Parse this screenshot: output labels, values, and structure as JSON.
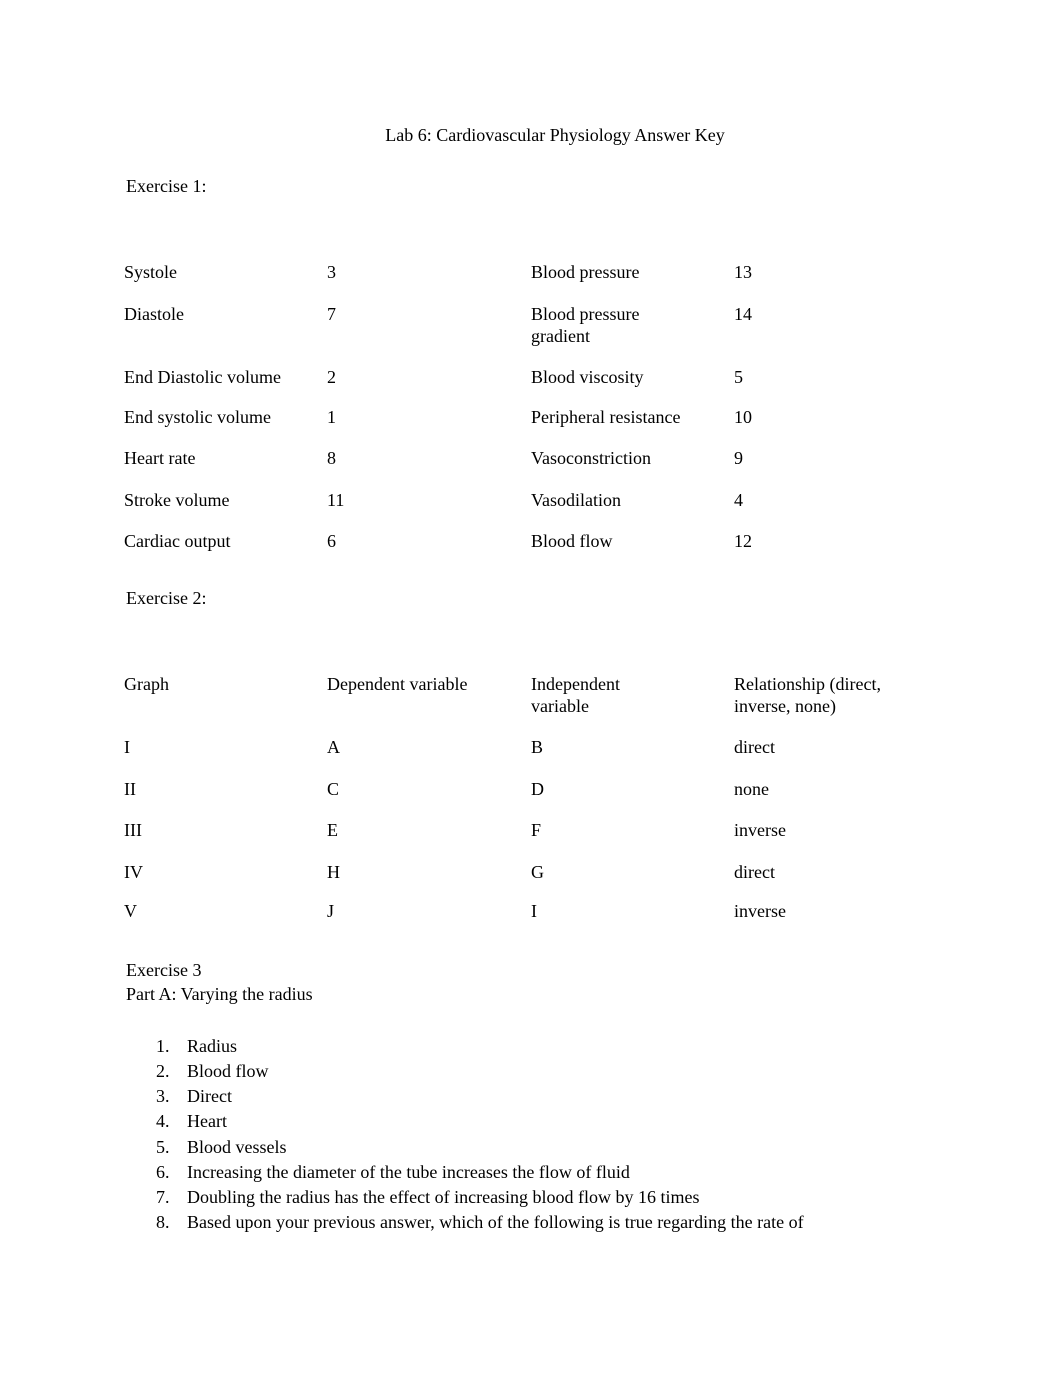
{
  "title": "Lab 6: Cardiovascular Physiology Answer Key",
  "exercise1": {
    "heading": "Exercise 1:",
    "left": [
      {
        "term": "Systole",
        "answer": "3"
      },
      {
        "term": "Diastole",
        "answer": "7"
      },
      {
        "term": "End Diastolic volume",
        "answer": "2"
      },
      {
        "term": "End systolic volume",
        "answer": "1"
      },
      {
        "term": "Heart rate",
        "answer": "8"
      },
      {
        "term": "Stroke volume",
        "answer": "11"
      },
      {
        "term": "Cardiac output",
        "answer": "6"
      }
    ],
    "right": [
      {
        "term": "Blood pressure",
        "answer": "13"
      },
      {
        "term": "Blood pressure gradient",
        "answer": "14"
      },
      {
        "term": "Blood viscosity",
        "answer": "5"
      },
      {
        "term": "Peripheral resistance",
        "answer": "10"
      },
      {
        "term": "Vasoconstriction",
        "answer": "9"
      },
      {
        "term": "Vasodilation",
        "answer": "4"
      },
      {
        "term": "Blood flow",
        "answer": "12"
      }
    ]
  },
  "exercise2": {
    "heading": "Exercise 2:",
    "columns": [
      "Graph",
      "Dependent variable",
      "Independent variable",
      "Relationship (direct, inverse, none)"
    ],
    "rows": [
      [
        "I",
        "A",
        "B",
        "direct"
      ],
      [
        "II",
        "C",
        "D",
        "none"
      ],
      [
        "III",
        "E",
        "F",
        "inverse"
      ],
      [
        "IV",
        "H",
        "G",
        "direct"
      ],
      [
        "V",
        "J",
        "I",
        "inverse"
      ]
    ]
  },
  "exercise3": {
    "heading": "Exercise 3",
    "subheading": "Part A: Varying the radius",
    "items": [
      {
        "n": "1.",
        "text": "Radius"
      },
      {
        "n": "2.",
        "text": "Blood flow"
      },
      {
        "n": "3.",
        "text": "Direct"
      },
      {
        "n": "4.",
        "text": "Heart"
      },
      {
        "n": "5.",
        "text": "Blood vessels"
      },
      {
        "n": "6.",
        "text": "Increasing the diameter of the tube increases the flow of fluid"
      },
      {
        "n": "7.",
        "text": "Doubling the radius has the effect of increasing blood flow by 16 times"
      },
      {
        "n": "8.",
        "text": "Based upon your previous answer, which of the following is true regarding the rate of"
      }
    ]
  }
}
